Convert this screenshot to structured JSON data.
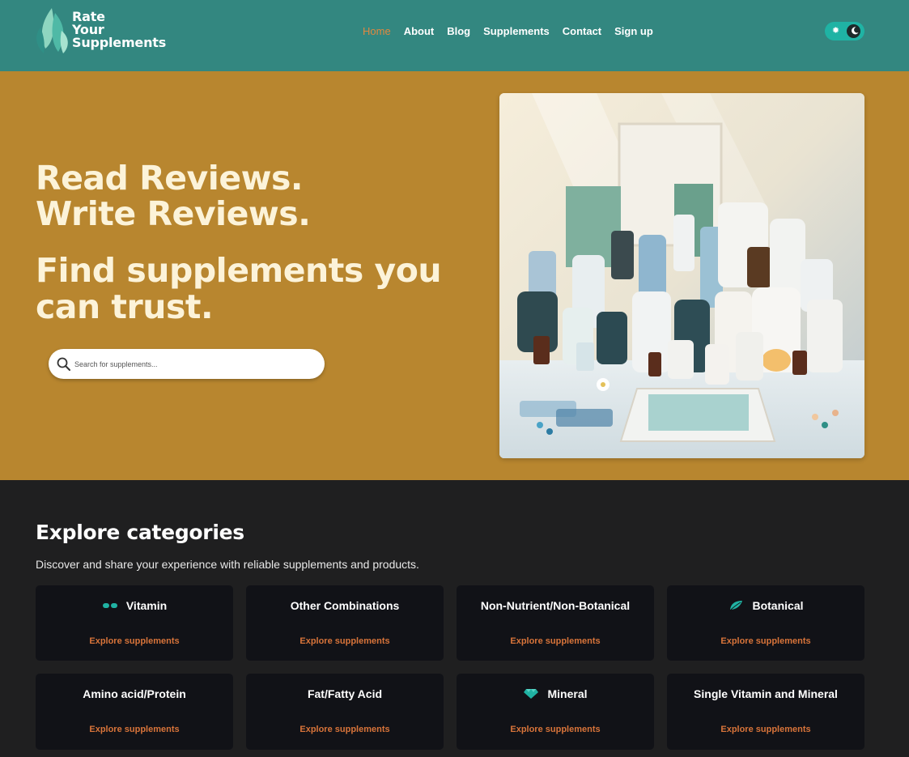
{
  "brand": {
    "line1": "Rate",
    "line2": "Your",
    "line3": "Supplements",
    "accent": "#338780"
  },
  "nav": {
    "items": [
      {
        "label": "Home",
        "active": true
      },
      {
        "label": "About",
        "active": false
      },
      {
        "label": "Blog",
        "active": false
      },
      {
        "label": "Supplements",
        "active": false
      },
      {
        "label": "Contact",
        "active": false
      },
      {
        "label": "Sign up",
        "active": false
      }
    ],
    "active_color": "#e1883f"
  },
  "theme_toggle": {
    "sun_icon": "sun-icon",
    "moon_icon": "moon-icon",
    "color": "#1fb3a4"
  },
  "hero": {
    "line1": "Read Reviews.",
    "line2": "Write Reviews.",
    "tagline1": "Find supplements you",
    "tagline2": "can trust.",
    "search_placeholder": "Search for supplements...",
    "background": "#b8862f",
    "text_color": "#fcf3d9"
  },
  "categories": {
    "title": "Explore categories",
    "subtitle": "Discover and share your experience with reliable supplements and products.",
    "link_label": "Explore supplements",
    "items": [
      {
        "name": "Vitamin",
        "icon": "pills-icon"
      },
      {
        "name": "Other Combinations",
        "icon": ""
      },
      {
        "name": "Non-Nutrient/Non-Botanical",
        "icon": ""
      },
      {
        "name": "Botanical",
        "icon": "leaf-icon"
      },
      {
        "name": "Amino acid/Protein",
        "icon": ""
      },
      {
        "name": "Fat/Fatty Acid",
        "icon": ""
      },
      {
        "name": "Mineral",
        "icon": "gem-icon"
      },
      {
        "name": "Single Vitamin and Mineral",
        "icon": ""
      }
    ],
    "link_color": "#d8743a",
    "card_color": "#111217"
  }
}
